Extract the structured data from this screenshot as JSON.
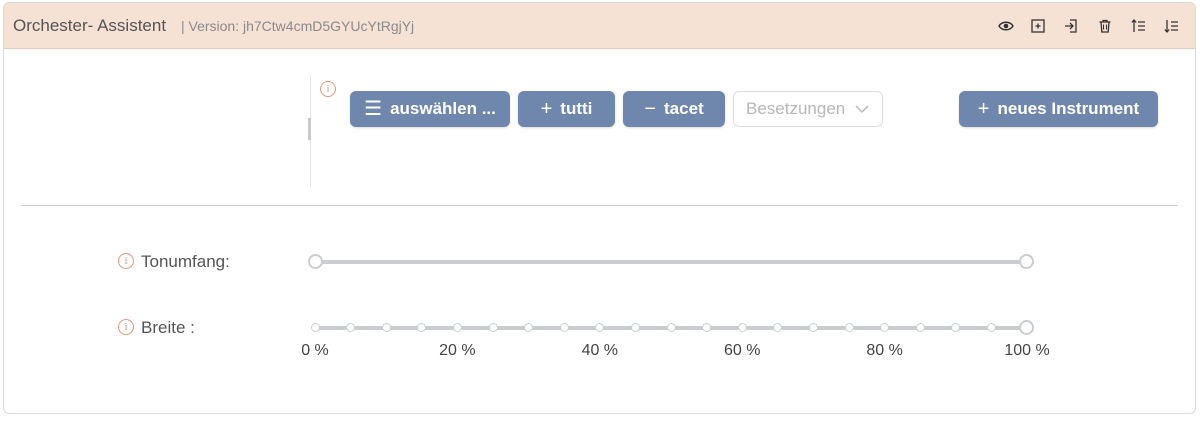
{
  "header": {
    "title": "Orchester- Assistent",
    "version": "| Version: jh7Ctw4cmD5GYUcYtRgjYj",
    "icons": [
      "eye-icon",
      "add-box-icon",
      "import-icon",
      "trash-icon",
      "sort-ascending-icon",
      "sort-descending-icon"
    ]
  },
  "toolbar": {
    "info": "i",
    "select_label": "auswählen ...",
    "tutti_label": "tutti",
    "tacet_label": "tacet",
    "besetzungen_placeholder": "Besetzungen",
    "new_instrument_label": "neues Instrument"
  },
  "fields": {
    "tonumfang": {
      "label": "Tonumfang",
      "colon": ":",
      "range": [
        0,
        100
      ]
    },
    "breite": {
      "label": "Breite",
      "colon": ":",
      "value": 100,
      "steps": 21,
      "ticks": [
        "0 %",
        "20 %",
        "40 %",
        "60 %",
        "80 %",
        "100 %"
      ]
    }
  },
  "colors": {
    "header_bg": "#f6e1d5",
    "button_bg": "#6f86ad",
    "info_accent": "#e0987a",
    "track": "#c9cdd2"
  }
}
